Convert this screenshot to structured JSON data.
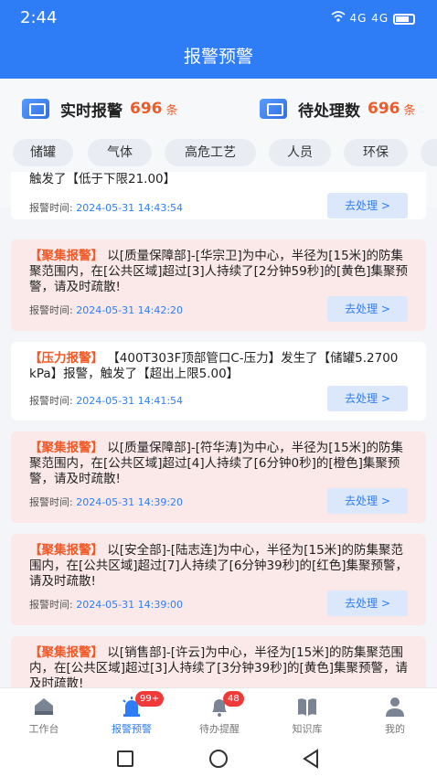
{
  "status_bar": {
    "time": "2:44",
    "signal_text": "4G 4G"
  },
  "app_bar": {
    "title": "报警预警"
  },
  "summary": {
    "realtime": {
      "label": "实时报警",
      "count": "696",
      "unit": "条"
    },
    "pending": {
      "label": "待处理数",
      "count": "696",
      "unit": "条"
    }
  },
  "categories": [
    "储罐",
    "气体",
    "高危工艺",
    "人员",
    "环保"
  ],
  "alarms": [
    {
      "tag": "",
      "text": "触发了【低于下限21.00】",
      "time_label": "报警时间:",
      "time": "2024-05-31 14:43:54",
      "action": "去处理 >",
      "style": "white"
    },
    {
      "tag": "【聚集报警】",
      "text": "以[质量保障部]-[华宗卫]为中心，半径为[15米]的防集聚范围内，在[公共区域]超过[3]人持续了[2分钟59秒]的[黄色]集聚预警，请及时疏散!",
      "time_label": "报警时间:",
      "time": "2024-05-31 14:42:20",
      "action": "去处理 >",
      "style": "pink"
    },
    {
      "tag": "【压力报警】",
      "text": "【400T303F顶部管口C-压力】发生了【储罐5.2700 kPa】报警，触发了【超出上限5.00】",
      "time_label": "报警时间:",
      "time": "2024-05-31 14:41:54",
      "action": "去处理 >",
      "style": "white"
    },
    {
      "tag": "【聚集报警】",
      "text": "以[质量保障部]-[符华涛]为中心，半径为[15米]的防集聚范围内，在[公共区域]超过[4]人持续了[6分钟0秒]的[橙色]集聚预警，请及时疏散!",
      "time_label": "报警时间:",
      "time": "2024-05-31 14:39:20",
      "action": "去处理 >",
      "style": "pink"
    },
    {
      "tag": "【聚集报警】",
      "text": "以[安全部]-[陆志连]为中心，半径为[15米]的防集聚范围内，在[公共区域]超过[7]人持续了[6分钟39秒]的[红色]集聚预警，请及时疏散!",
      "time_label": "报警时间:",
      "time": "2024-05-31 14:39:00",
      "action": "去处理 >",
      "style": "pink"
    },
    {
      "tag": "【聚集报警】",
      "text": "以[销售部]-[许云]为中心，半径为[15米]的防集聚范围内，在[公共区域]超过[3]人持续了[3分钟39秒]的[黄色]集聚预警，请及时疏散!",
      "time_label": "",
      "time": "",
      "action": "",
      "style": "pink"
    }
  ],
  "tabbar": {
    "items": [
      {
        "label": "工作台",
        "icon": "home-icon"
      },
      {
        "label": "报警预警",
        "icon": "alarm-bell-icon",
        "badge": "99+"
      },
      {
        "label": "待办提醒",
        "icon": "bell-icon",
        "badge": "48"
      },
      {
        "label": "知识库",
        "icon": "book-icon"
      },
      {
        "label": "我的",
        "icon": "user-icon"
      }
    ],
    "active": "报警预警"
  },
  "colors": {
    "primary": "#2f7df6",
    "alert": "#f05a28",
    "badge": "#f03a3a",
    "pink_card": "#fbe9e9"
  }
}
